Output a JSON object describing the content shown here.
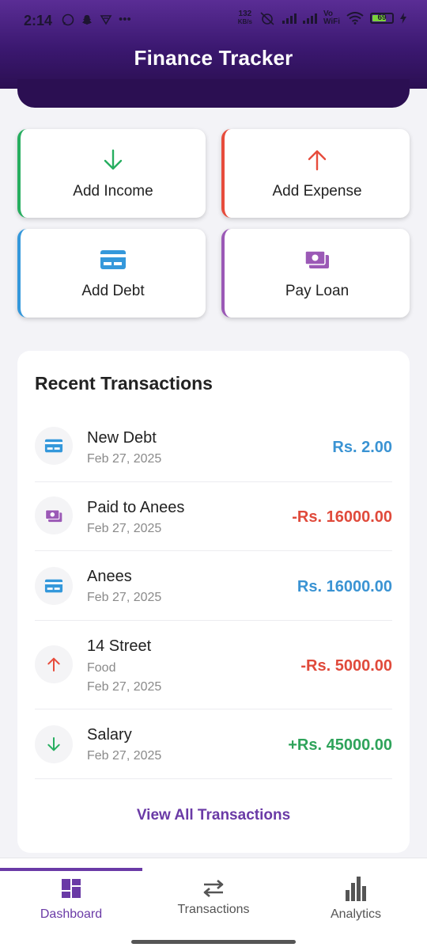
{
  "status_bar": {
    "time": "2:14",
    "net_speed_value": "132",
    "net_speed_unit": "KB/s",
    "volte_top": "Vo",
    "volte_bottom": "WiFi",
    "battery": "69"
  },
  "header": {
    "title": "Finance Tracker"
  },
  "actions": {
    "income": {
      "label": "Add Income",
      "icon": "arrow-down-icon",
      "color": "#27ae60"
    },
    "expense": {
      "label": "Add Expense",
      "icon": "arrow-up-icon",
      "color": "#e74c3c"
    },
    "debt": {
      "label": "Add Debt",
      "icon": "credit-card-icon",
      "color": "#3498db"
    },
    "loan": {
      "label": "Pay Loan",
      "icon": "money-icon",
      "color": "#9b59b6"
    }
  },
  "recent": {
    "title": "Recent Transactions",
    "items": [
      {
        "name": "New Debt",
        "category": "",
        "date": "Feb 27, 2025",
        "amount": "Rs. 2.00",
        "icon": "credit-card-icon",
        "type": "debt"
      },
      {
        "name": "Paid to Anees",
        "category": "",
        "date": "Feb 27, 2025",
        "amount": "-Rs. 16000.00",
        "icon": "money-icon",
        "type": "loan"
      },
      {
        "name": "Anees",
        "category": "",
        "date": "Feb 27, 2025",
        "amount": "Rs. 16000.00",
        "icon": "credit-card-icon",
        "type": "debt"
      },
      {
        "name": "14 Street",
        "category": "Food",
        "date": "Feb 27, 2025",
        "amount": "-Rs. 5000.00",
        "icon": "arrow-up-icon",
        "type": "expense"
      },
      {
        "name": "Salary",
        "category": "",
        "date": "Feb 27, 2025",
        "amount": "+Rs. 45000.00",
        "icon": "arrow-down-icon",
        "type": "income"
      }
    ],
    "view_all": "View All Transactions"
  },
  "nav": {
    "dashboard": "Dashboard",
    "transactions": "Transactions",
    "analytics": "Analytics",
    "active": "dashboard",
    "accent": "#6a3aa6"
  }
}
